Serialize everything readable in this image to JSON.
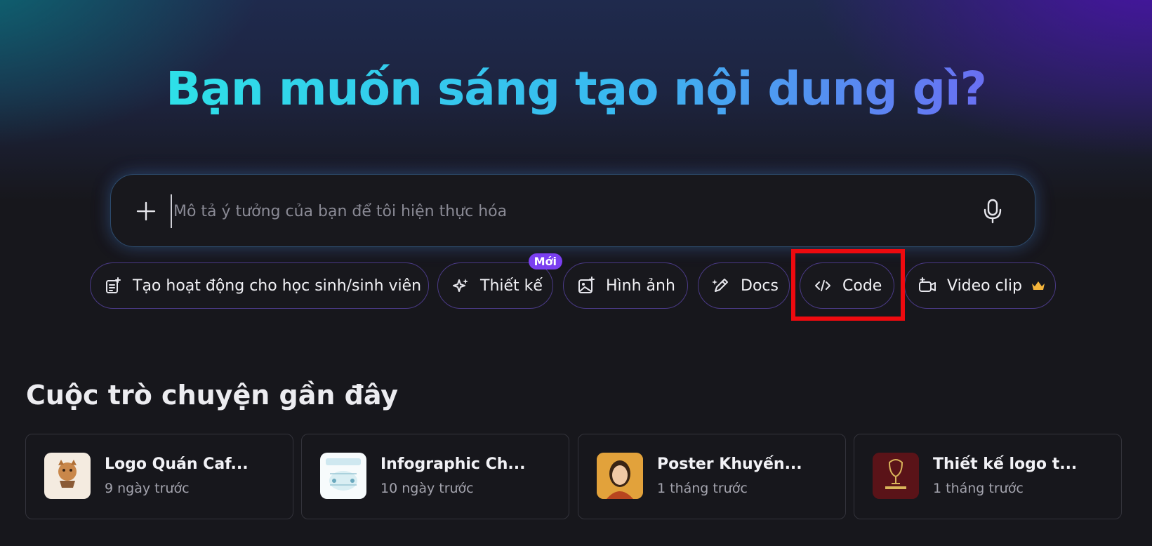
{
  "hero": {
    "title": "Bạn muốn sáng tạo nội dung gì?"
  },
  "prompt": {
    "placeholder": "Mô tả ý tưởng của bạn để tôi hiện thực hóa",
    "value": ""
  },
  "chips": [
    {
      "label": "Tạo hoạt động cho học sinh/sinh viên",
      "icon": "activity-list-icon"
    },
    {
      "label": "Thiết kế",
      "icon": "sparkle-icon",
      "badge": "Mới"
    },
    {
      "label": "Hình ảnh",
      "icon": "image-add-icon"
    },
    {
      "label": "Docs",
      "icon": "magic-pen-icon"
    },
    {
      "label": "Code",
      "icon": "code-icon"
    },
    {
      "label": "Video clip",
      "icon": "video-camera-icon",
      "premium": "crown-icon"
    }
  ],
  "recent": {
    "title": "Cuộc trò chuyện gần đây",
    "items": [
      {
        "title": "Logo Quán Caf...",
        "time": "9 ngày trước"
      },
      {
        "title": "Infographic Ch...",
        "time": "10 ngày trước"
      },
      {
        "title": "Poster Khuyến...",
        "time": "1 tháng trước"
      },
      {
        "title": "Thiết kế logo t...",
        "time": "1 tháng trước"
      }
    ]
  },
  "colors": {
    "accent_purple": "#7b3ff0",
    "highlight_red": "#ee0a0f",
    "title_gradient_start": "#2ee0e8",
    "title_gradient_end": "#6a6ff2"
  }
}
